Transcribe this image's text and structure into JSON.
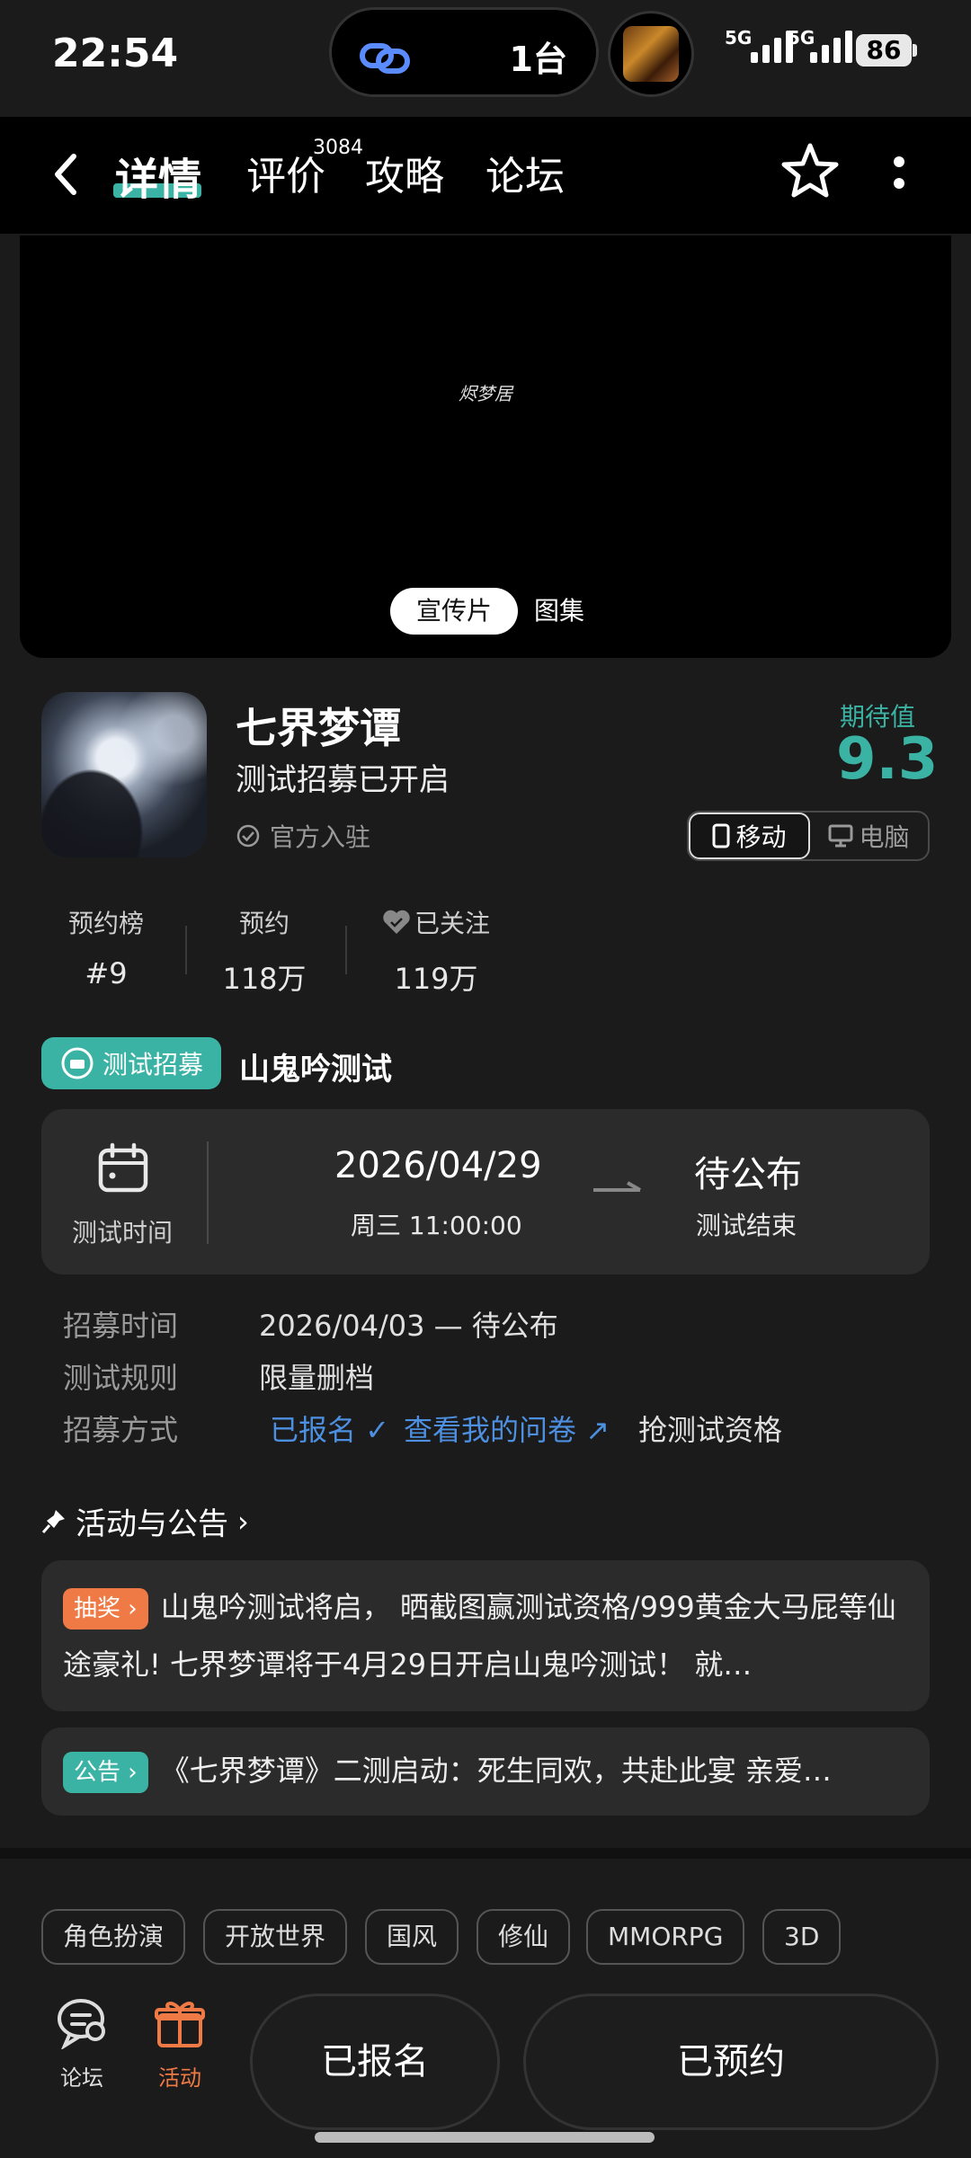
{
  "status": {
    "time": "22:54",
    "pill_count": "1台",
    "net1": "5G",
    "net2": "5G",
    "battery": "86"
  },
  "nav": {
    "tabs": [
      {
        "label": "详情",
        "active": true
      },
      {
        "label": "评价",
        "badge": "3084"
      },
      {
        "label": "攻略"
      },
      {
        "label": "论坛"
      }
    ]
  },
  "media": {
    "logo_text": "烬梦居",
    "tabs": [
      "宣传片",
      "图集"
    ]
  },
  "game": {
    "title": "七界梦谭",
    "subtitle": "测试招募已开启",
    "official": "官方入驻",
    "expectation_label": "期待值",
    "expectation_value": "9.3",
    "platforms": [
      "移动",
      "电脑"
    ]
  },
  "stats": [
    {
      "label": "预约榜",
      "value": "#9"
    },
    {
      "label": "预约",
      "value": "118万"
    },
    {
      "label": "已关注",
      "value": "119万"
    }
  ],
  "recruit": {
    "badge": "测试招募",
    "name": "山鬼吟测试",
    "time_label": "测试时间",
    "start_date": "2026/04/29",
    "start_sub": "周三  11:00:00",
    "end_status": "待公布",
    "end_label": "测试结束",
    "rows": [
      {
        "label": "招募时间",
        "value": "2026/04/03 — 待公布"
      },
      {
        "label": "测试规则",
        "value": "限量删档"
      },
      {
        "label": "招募方式",
        "registered": "已报名",
        "questionnaire": "查看我的问卷",
        "extra": "抢测试资格"
      }
    ]
  },
  "activities": {
    "heading": "活动与公告",
    "items": [
      {
        "tag": "抽奖",
        "text": "山鬼吟测试将启， 晒截图赢测试资格/999黄金大马屁等仙途豪礼! 七界梦谭将于4月29日开启山鬼吟测试！ 就…"
      },
      {
        "tag": "公告",
        "text": "《七界梦谭》二测启动：死生同欢，共赴此宴 亲爱…"
      }
    ]
  },
  "genres": [
    "角色扮演",
    "开放世界",
    "国风",
    "修仙",
    "MMORPG",
    "3D"
  ],
  "bottom": {
    "forum": "论坛",
    "activity": "活动",
    "signup_btn": "已报名",
    "reserve_btn": "已预约"
  },
  "colors": {
    "accent": "#3bb3a4",
    "lottery": "#f07a45",
    "link": "#4d8fe0"
  }
}
